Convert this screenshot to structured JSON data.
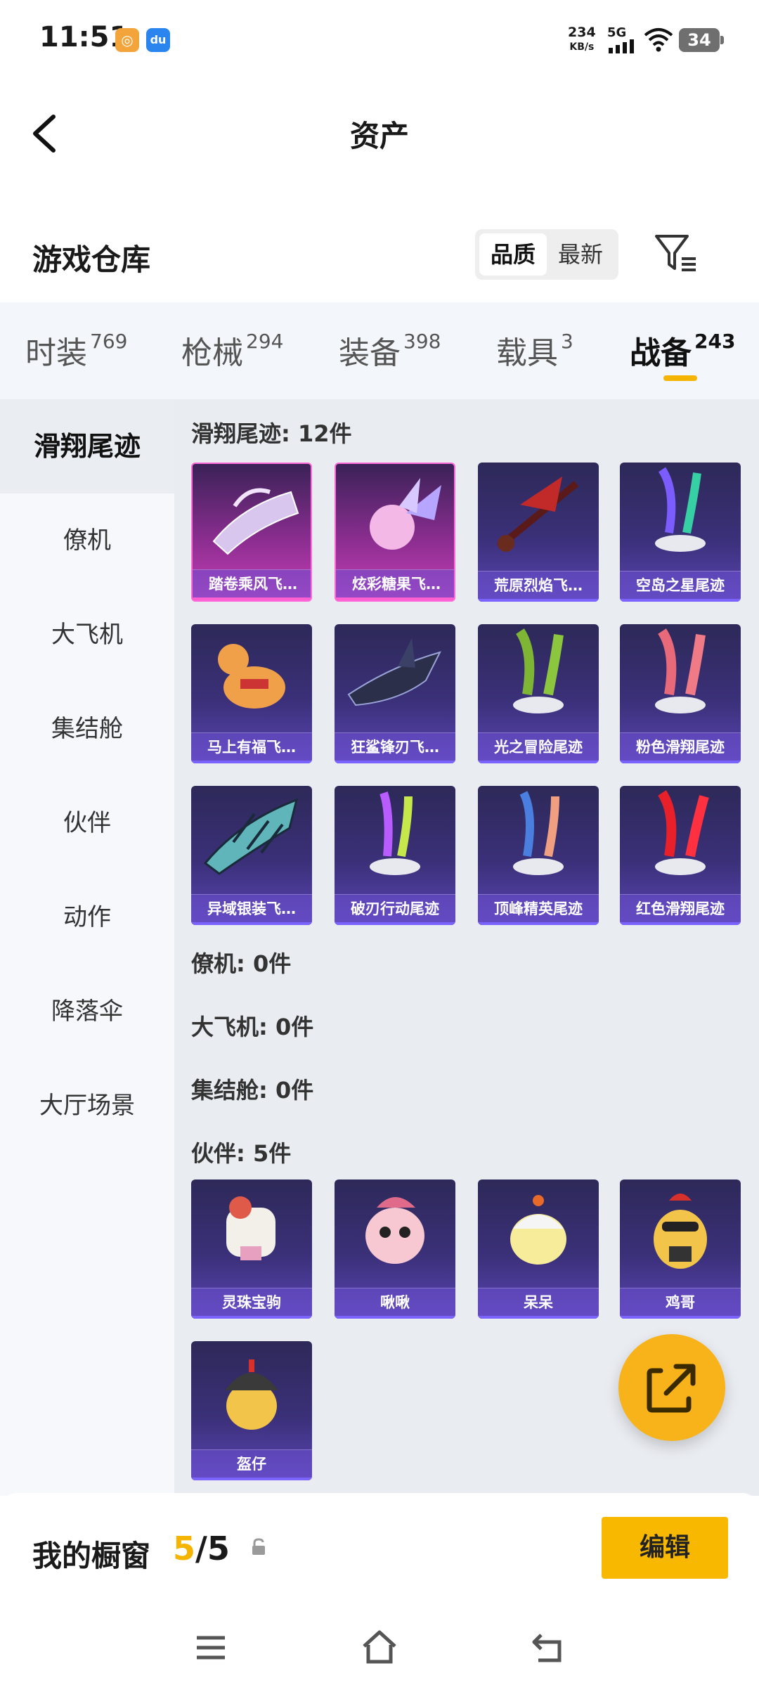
{
  "status_bar": {
    "time": "11:51",
    "app_icon_1": "di-icon",
    "app_icon_2": "du",
    "speed_value": "234",
    "speed_unit": "KB/s",
    "network": "5G",
    "battery": "34"
  },
  "header": {
    "title": "资产"
  },
  "section": {
    "title": "游戏仓库",
    "sort_options": [
      "品质",
      "最新"
    ],
    "sort_active": "品质"
  },
  "tabs": [
    {
      "label": "时装",
      "count": "769"
    },
    {
      "label": "枪械",
      "count": "294"
    },
    {
      "label": "装备",
      "count": "398"
    },
    {
      "label": "载具",
      "count": "3"
    },
    {
      "label": "战备",
      "count": "243"
    }
  ],
  "sidebar": {
    "items": [
      "滑翔尾迹",
      "僚机",
      "大飞机",
      "集结舱",
      "伙伴",
      "动作",
      "降落伞",
      "大厅场景"
    ],
    "active": "滑翔尾迹"
  },
  "groups": {
    "glide": {
      "label": "滑翔尾迹: 12件",
      "items": [
        {
          "name": "踏卷乘风飞…",
          "rarity": "pink"
        },
        {
          "name": "炫彩糖果飞…",
          "rarity": "pink"
        },
        {
          "name": "荒原烈焰飞…",
          "rarity": "purple"
        },
        {
          "name": "空岛之星尾迹",
          "rarity": "purple"
        },
        {
          "name": "马上有福飞…",
          "rarity": "purple"
        },
        {
          "name": "狂鲨锋刃飞…",
          "rarity": "purple"
        },
        {
          "name": "光之冒险尾迹",
          "rarity": "purple"
        },
        {
          "name": "粉色滑翔尾迹",
          "rarity": "purple"
        },
        {
          "name": "异域银装飞…",
          "rarity": "purple"
        },
        {
          "name": "破刃行动尾迹",
          "rarity": "purple"
        },
        {
          "name": "顶峰精英尾迹",
          "rarity": "purple"
        },
        {
          "name": "红色滑翔尾迹",
          "rarity": "purple"
        }
      ]
    },
    "wingman": {
      "label": "僚机: 0件"
    },
    "big_plane": {
      "label": "大飞机: 0件"
    },
    "rally_pod": {
      "label": "集结舱: 0件"
    },
    "partner": {
      "label": "伙伴: 5件",
      "items": [
        {
          "name": "灵珠宝驹"
        },
        {
          "name": "啾啾"
        },
        {
          "name": "呆呆"
        },
        {
          "name": "鸡哥"
        },
        {
          "name": "盔仔"
        }
      ]
    }
  },
  "showcase": {
    "title": "我的橱窗",
    "current": "5",
    "total": "/5",
    "edit_label": "编辑"
  },
  "colors": {
    "accent": "#f8b800",
    "card_purple": "#3b3079",
    "card_pink": "#c83fb7"
  }
}
